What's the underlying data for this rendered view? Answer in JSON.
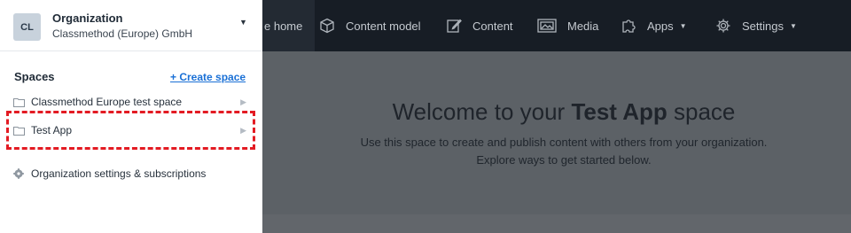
{
  "topnav": {
    "space_home": "e home",
    "content_model": "Content model",
    "content": "Content",
    "media": "Media",
    "apps": "Apps",
    "settings": "Settings"
  },
  "main": {
    "welcome_prefix": "Welcome to your ",
    "welcome_space": "Test App",
    "welcome_suffix": " space",
    "line1": "Use this space to create and publish content with others from your organization.",
    "line2": "Explore ways to get started below."
  },
  "panel": {
    "avatar": "CL",
    "org_label": "Organization",
    "org_name": "Classmethod (Europe) GmbH",
    "spaces_title": "Spaces",
    "create_space": "+ Create space",
    "spaces": [
      {
        "label": "Classmethod Europe test space"
      },
      {
        "label": "Test App"
      }
    ],
    "org_settings": "Organization settings & subscriptions"
  },
  "colors": {
    "nav_bg": "#171d25",
    "overlay": "#5c6166",
    "link": "#1a70d6",
    "highlight": "#e31b23"
  }
}
